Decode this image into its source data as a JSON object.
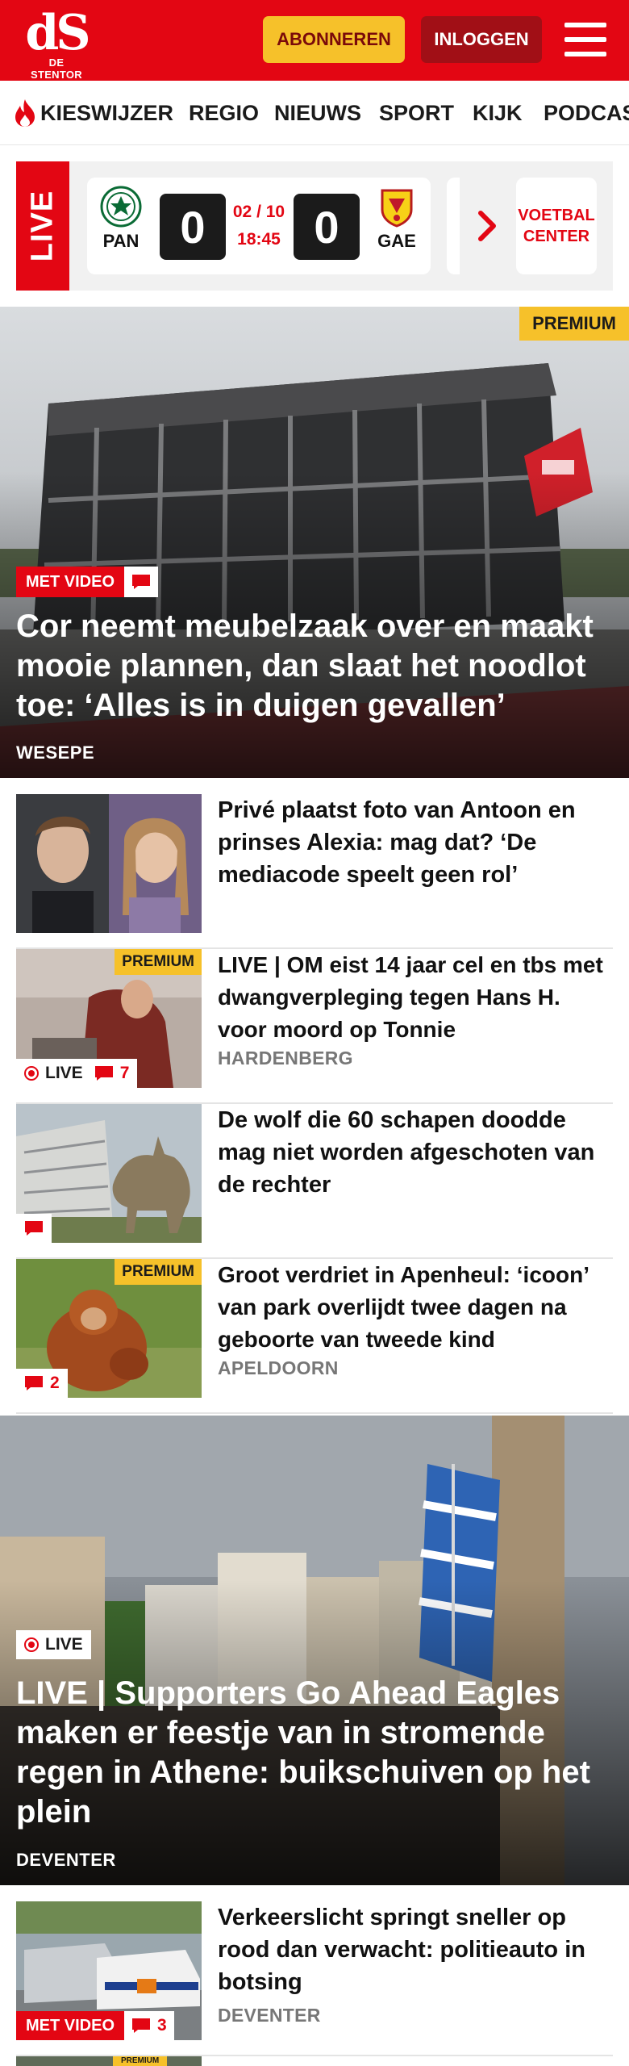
{
  "header": {
    "logo_mark": "dS",
    "logo_name": "DE STENTOR",
    "subscribe_label": "ABONNEREN",
    "login_label": "INLOGGEN"
  },
  "nav": {
    "items": [
      "KIESWIJZER",
      "REGIO",
      "NIEUWS",
      "SPORT",
      "KIJK",
      "PODCAST"
    ]
  },
  "live_scores": {
    "tab_label": "LIVE",
    "match": {
      "home": "PAN",
      "home_score": "0",
      "away": "GAE",
      "away_score": "0",
      "date": "02 / 10",
      "time": "18:45"
    },
    "football_center_label": "VOETBAL CENTER"
  },
  "hero1": {
    "premium": "PREMIUM",
    "badge": "MET VIDEO",
    "title": "Cor neemt meubelzaak over en maakt mooie plannen, dan slaat het noodlot toe: ‘Alles is in duigen gevallen’",
    "location": "WESEPE"
  },
  "articles": [
    {
      "title": "Privé plaatst foto van Antoon en prinses Alexia: mag dat? ‘De mediacode speelt geen rol’",
      "location": "",
      "premium": "",
      "live": "",
      "comments": ""
    },
    {
      "title": "LIVE | OM eist 14 jaar cel en tbs met dwangverpleging tegen Hans H. voor moord op Tonnie",
      "location": "HARDENBERG",
      "premium": "PREMIUM",
      "live": "LIVE",
      "comments": "7"
    },
    {
      "title": "De wolf die 60 schapen doodde mag niet worden afgeschoten van de rechter",
      "location": "",
      "premium": "",
      "live": "",
      "comments": ""
    },
    {
      "title": "Groot verdriet in Apenheul: ‘icoon’ van park overlijdt twee dagen na geboorte van tweede kind",
      "location": "APELDOORN",
      "premium": "PREMIUM",
      "live": "",
      "comments": "2"
    }
  ],
  "hero2": {
    "live": "LIVE",
    "title": "LIVE | Supporters Go Ahead Eagles maken er feestje van in stromende regen in Athene: buikschuiven op het plein",
    "location": "DEVENTER"
  },
  "article_after": {
    "title": "Verkeerslicht springt sneller op rood dan verwacht: politieauto in botsing",
    "location": "DEVENTER",
    "badge": "MET VIDEO",
    "comments": "3"
  },
  "article_peek": {
    "premium": "PREMIUM"
  },
  "colors": {
    "brand_red": "#e30613",
    "premium_yellow": "#f6c12a",
    "login_dark_red": "#a10f16"
  }
}
